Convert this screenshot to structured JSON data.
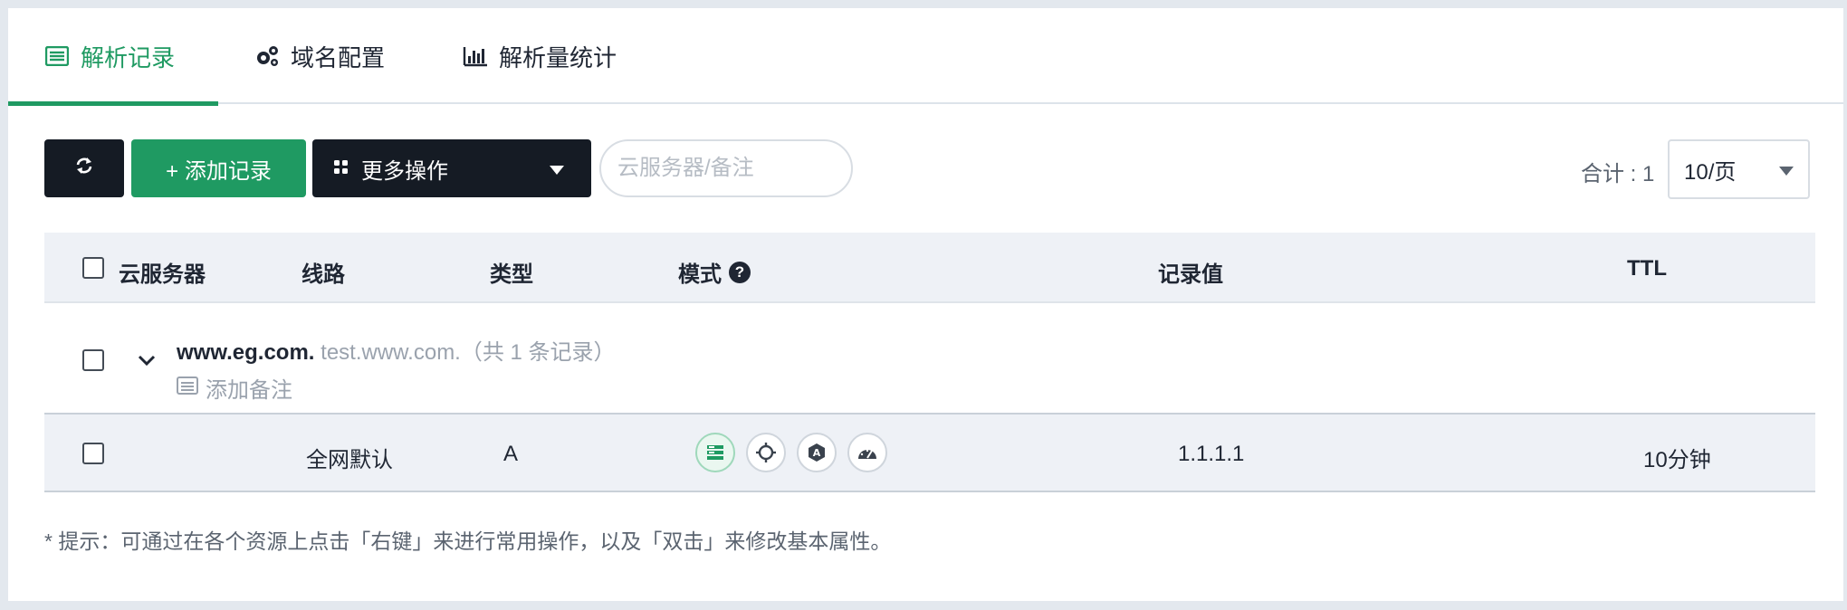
{
  "tabs": [
    {
      "label": "解析记录",
      "icon": "list-icon",
      "active": true
    },
    {
      "label": "域名配置",
      "icon": "gears-icon",
      "active": false
    },
    {
      "label": "解析量统计",
      "icon": "bar-chart-icon",
      "active": false
    }
  ],
  "toolbar": {
    "refresh_icon": "refresh-icon",
    "add_label": "+ 添加记录",
    "more_label": "更多操作",
    "search_placeholder": "云服务器/备注",
    "total_text": "合计 : 1",
    "page_size": "10/页"
  },
  "table": {
    "columns": [
      "云服务器",
      "线路",
      "类型",
      "模式",
      "记录值",
      "TTL"
    ],
    "group": {
      "domain": "www.eg.com.",
      "sub": " test.www.com.",
      "count_text": "（共 1 条记录）",
      "note_label": "添加备注"
    },
    "rows": [
      {
        "server": "",
        "line": "全网默认",
        "type": "A",
        "value": "1.1.1.1",
        "ttl": "10分钟",
        "modes": [
          "server-mode-icon",
          "target-mode-icon",
          "auto-mode-icon",
          "speed-mode-icon"
        ]
      }
    ]
  },
  "tip": "* 提示：可通过在各个资源上点击「右键」来进行常用操作，以及「双击」来修改基本属性。",
  "colors": {
    "accent": "#1f9a62",
    "dark": "#151b24",
    "header_bg": "#eef1f6"
  }
}
